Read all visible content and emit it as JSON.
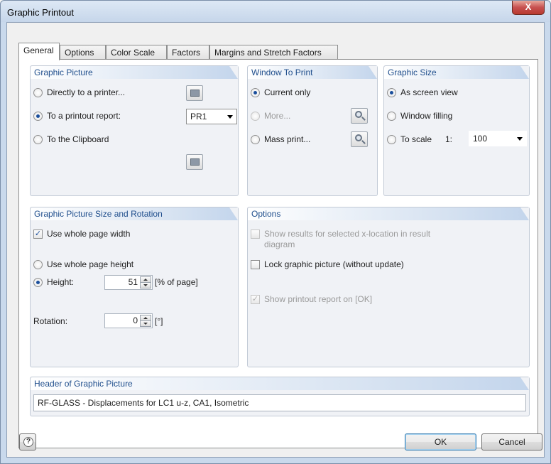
{
  "window": {
    "title": "Graphic Printout",
    "close_glyph": "X"
  },
  "tabs": [
    {
      "label": "General",
      "active": true
    },
    {
      "label": "Options"
    },
    {
      "label": "Color Scale"
    },
    {
      "label": "Factors"
    },
    {
      "label": "Margins and Stretch Factors"
    }
  ],
  "graphic_picture": {
    "heading": "Graphic Picture",
    "directly_to_printer": "Directly to a printer...",
    "to_printout_report": "To a printout report:",
    "report_selected": "PR1",
    "to_clipboard": "To the Clipboard",
    "selected": "to_printout_report"
  },
  "window_to_print": {
    "heading": "Window To Print",
    "current_only": "Current only",
    "more": "More...",
    "mass_print": "Mass print...",
    "selected": "current_only"
  },
  "graphic_size": {
    "heading": "Graphic Size",
    "as_screen_view": "As screen view",
    "window_filling": "Window filling",
    "to_scale": "To scale",
    "scale_prefix": "1:",
    "scale_value": "100",
    "selected": "as_screen_view"
  },
  "size_rotation": {
    "heading": "Graphic Picture Size and Rotation",
    "use_whole_page_width": "Use whole page width",
    "use_whole_page_width_checked": true,
    "use_whole_page_height": "Use whole page height",
    "height_label": "Height:",
    "height_value": "51",
    "height_unit": "[% of page]",
    "height_selected": true,
    "rotation_label": "Rotation:",
    "rotation_value": "0",
    "rotation_unit": "[°]"
  },
  "options": {
    "heading": "Options",
    "show_results_line1": "Show results for selected x-location in result",
    "show_results_line2": "diagram",
    "lock_graphic": "Lock graphic picture (without update)",
    "show_printout_report": "Show printout report on [OK]",
    "show_printout_report_checked": true
  },
  "header_picture": {
    "heading": "Header of Graphic Picture",
    "value": "RF-GLASS - Displacements for LC1 u-z, CA1, Isometric"
  },
  "footer": {
    "ok": "OK",
    "cancel": "Cancel",
    "help_glyph": "?"
  }
}
